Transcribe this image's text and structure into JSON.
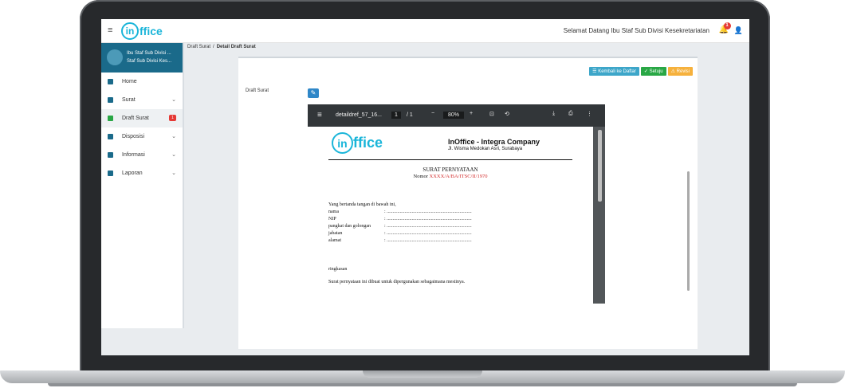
{
  "app": {
    "logo_text": "ffice",
    "logo_ring": "in",
    "greeting": "Selamat Datang Ibu Staf Sub Divisi Kesekretariatan",
    "notif_count": "1"
  },
  "profile": {
    "line1": "Ibu Staf Sub Divisi ...",
    "line2": "Staf Sub Divisi Kes..."
  },
  "nav": [
    {
      "label": "Home"
    },
    {
      "label": "Surat",
      "chevron": "⌄"
    },
    {
      "label": "Draft Surat",
      "badge": "1"
    },
    {
      "label": "Disposisi",
      "chevron": "⌄"
    },
    {
      "label": "Informasi",
      "chevron": "⌄"
    },
    {
      "label": "Laporan",
      "chevron": "⌄"
    }
  ],
  "breadcrumb": {
    "parent": "Draft Surat",
    "separator": "/",
    "current": "Detail Draft Surat"
  },
  "actions": {
    "back": "☰ Kembali ke Daftar",
    "approve": "✓ Setuju",
    "revise": "⚠ Revisi"
  },
  "form": {
    "label": "Draft Surat"
  },
  "viewer": {
    "filename": "detaildref_57_16...",
    "page": "1",
    "page_total": "/ 1",
    "zoom": "80%"
  },
  "doc": {
    "logo_ring": "in",
    "logo_text": "ffice",
    "company": "InOffice - Integra Company",
    "address": "Jl. Wisma Medokan Asri, Surabaya",
    "title": "SURAT PERNYATAAN",
    "number_label": "Nomor",
    "number_value": "XXXX/A/BA/ITSC/II/1970",
    "intro": "Yang bertanda tangan di bawah ini,",
    "fields": [
      {
        "label": "nama",
        "value": ": ......................................................................."
      },
      {
        "label": "NIP",
        "value": ": ......................................................................."
      },
      {
        "label": "pangkat dan golongan",
        "value": ": ......................................................................."
      },
      {
        "label": "jabatan",
        "value": ": ......................................................................."
      },
      {
        "label": "alamat",
        "value": ": ......................................................................."
      }
    ],
    "summary": "ringkasan",
    "closing": "Surat pernyataan ini dibuat untuk dipergunakan sebagaimana mestinya."
  }
}
